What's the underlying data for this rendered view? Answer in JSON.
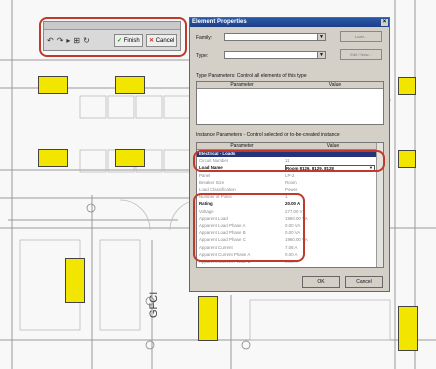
{
  "toolbar": {
    "finish_label": "Finish",
    "cancel_label": "Cancel",
    "icons": [
      "undo-icon",
      "redo-icon",
      "pick-icon",
      "filter-icon",
      "refresh-icon"
    ]
  },
  "dialog": {
    "title": "Element Properties",
    "family_label": "Family:",
    "type_label": "Type:",
    "load_button": "Load...",
    "edit_new_button": "Edit / New...",
    "type_params_title": "Type Parameters: Control all elements of this type",
    "instance_params_title": "Instance Parameters - Control selected or to-be-created instance",
    "col_parameter": "Parameter",
    "col_value": "Value",
    "rows": [
      {
        "p": "Electrical - Loads",
        "v": "",
        "kind": "group"
      },
      {
        "p": "Circuit Number",
        "v": "11",
        "kind": "grey"
      },
      {
        "p": "Load Name",
        "v": "Room 8126, 8129, 8128",
        "kind": "select"
      },
      {
        "p": "Panel",
        "v": "LP-2",
        "kind": "grey"
      },
      {
        "p": "Breaker Size",
        "v": "Room",
        "kind": "grey"
      },
      {
        "p": "Load Classification",
        "v": "Power",
        "kind": "grey"
      },
      {
        "p": "Number of Poles",
        "v": "1",
        "kind": "grey"
      },
      {
        "p": "Rating",
        "v": "20.00 A",
        "kind": "bold"
      },
      {
        "p": "Voltage",
        "v": "277.00 V",
        "kind": "grey"
      },
      {
        "p": "Apparent Load",
        "v": "1960.00 VA",
        "kind": "grey"
      },
      {
        "p": "Apparent Load Phase A",
        "v": "0.00 VA",
        "kind": "grey"
      },
      {
        "p": "Apparent Load Phase B",
        "v": "0.00 VA",
        "kind": "grey"
      },
      {
        "p": "Apparent Load Phase C",
        "v": "1960.00 VA",
        "kind": "grey"
      },
      {
        "p": "Apparent Current",
        "v": "7.08 A",
        "kind": "grey"
      },
      {
        "p": "Apparent Current Phase A",
        "v": "0.00 A",
        "kind": "grey"
      },
      {
        "p": "Apparent Current Phase B",
        "v": "0.00 A",
        "kind": "grey"
      }
    ],
    "ok_label": "OK",
    "cancel_label": "Cancel"
  },
  "plan": {
    "label": "GFCI"
  },
  "colors": {
    "fixture": "#f2e600",
    "highlight": "#c0392b",
    "titlebar": "#1d3f86"
  }
}
